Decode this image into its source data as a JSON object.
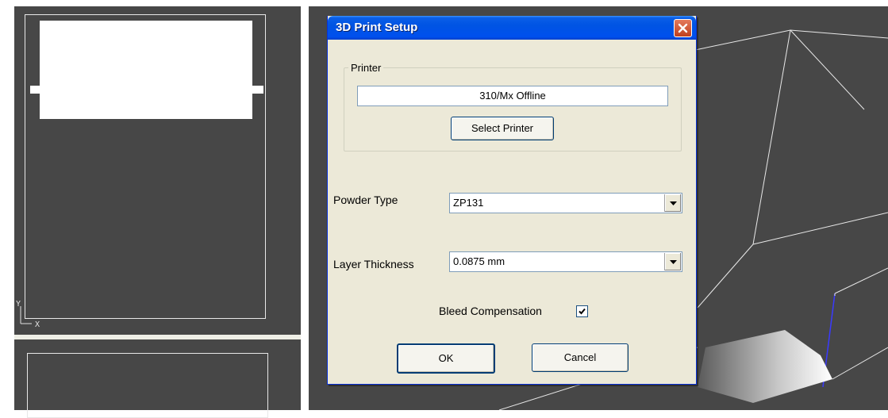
{
  "dialog": {
    "title": "3D Print Setup",
    "printer_group_label": "Printer",
    "printer_status": "310/Mx Offline",
    "select_printer_label": "Select Printer",
    "powder_type_label": "Powder Type",
    "powder_type_value": "ZP131",
    "layer_thickness_label": "Layer Thickness",
    "layer_thickness_value": "0.0875 mm",
    "bleed_compensation_label": "Bleed Compensation",
    "bleed_compensation_checked": true,
    "ok_label": "OK",
    "cancel_label": "Cancel"
  },
  "viewport": {
    "axis_y": "Y",
    "axis_x": "X"
  },
  "colors": {
    "viewport_bg": "#474747",
    "dialog_bg": "#ece9d8",
    "titlebar": "#0054e3",
    "close_button": "#c1401d"
  }
}
